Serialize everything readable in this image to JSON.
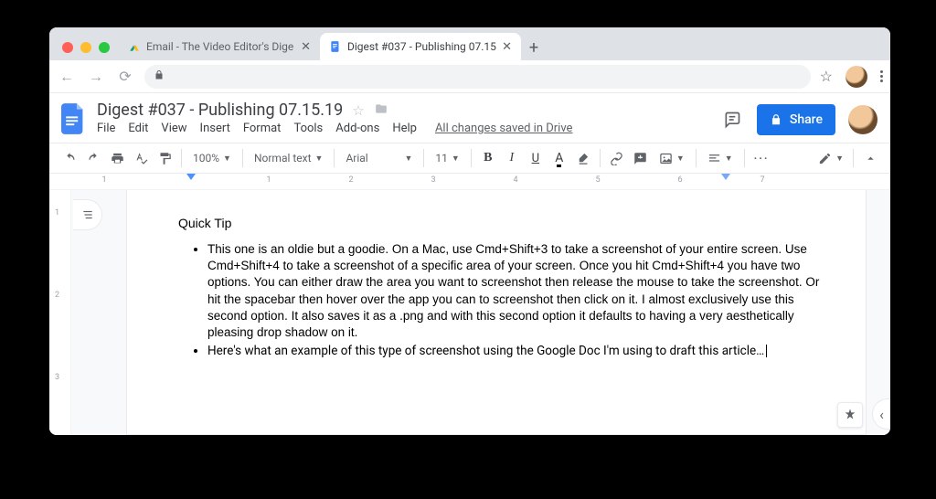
{
  "browser": {
    "tabs": [
      {
        "title": "Email - The Video Editor's Dige",
        "active": false
      },
      {
        "title": "Digest #037 - Publishing 07.15",
        "active": true
      }
    ]
  },
  "docs": {
    "title": "Digest #037 - Publishing 07.15.19",
    "menu": {
      "file": "File",
      "edit": "Edit",
      "view": "View",
      "insert": "Insert",
      "format": "Format",
      "tools": "Tools",
      "addons": "Add-ons",
      "help": "Help",
      "saved": "All changes saved in Drive"
    },
    "share": "Share",
    "toolbar": {
      "zoom": "100%",
      "style": "Normal text",
      "font": "Arial",
      "size": "11"
    },
    "ruler_nums": [
      "1",
      "1",
      "2",
      "3",
      "4",
      "5",
      "6",
      "7"
    ]
  },
  "doc": {
    "heading": "Quick Tip",
    "bullets": [
      "This one is an oldie but a goodie. On a Mac, use Cmd+Shift+3 to take a screenshot of your entire screen. Use Cmd+Shift+4 to take a screenshot of a specific area of your screen. Once you hit Cmd+Shift+4 you have two options. You can either draw the area you want to screenshot then release the mouse to take the screenshot. Or hit the spacebar then hover over the app you can to screenshot then click on it. I almost exclusively use this second option. It also saves it as a .png and with this second option it defaults to having a very aesthetically pleasing drop shadow on it.",
      "Here's what an example of this type of screenshot using the Google Doc I'm using to draft this article…"
    ]
  }
}
